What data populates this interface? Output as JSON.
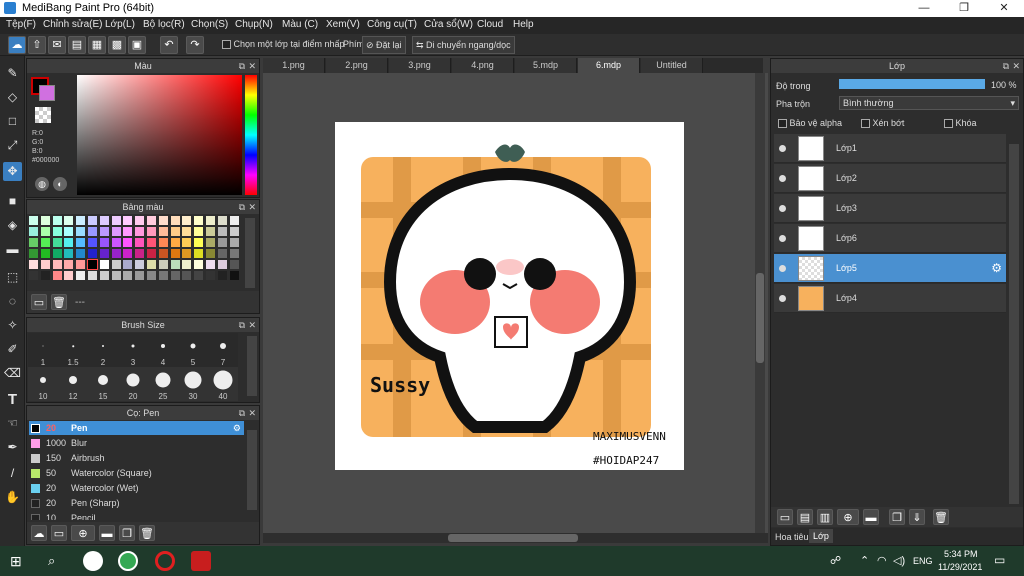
{
  "window": {
    "title": "MediBang Paint Pro (64bit)",
    "min": "—",
    "max": "❐",
    "close": "✕"
  },
  "menu": [
    "Tệp(F)",
    "Chỉnh sửa(E)",
    "Lớp(L)",
    "Bộ lọc(R)",
    "Chọn(S)",
    "Chụp(N)",
    "Màu (C)",
    "Xem(V)",
    "Công cụ(T)",
    "Cửa sổ(W)",
    "Cloud",
    "Help"
  ],
  "toolbar": {
    "select_layer_label": "Chọn một lớp tại điểm nhấp",
    "key_label": "Phím",
    "reset_label": "Đặt lại",
    "move_label": "Di chuyển ngang/dọc"
  },
  "color_panel": {
    "title": "Màu",
    "r": "R:0",
    "g": "G:0",
    "b": "B:0",
    "hex": "#000000"
  },
  "palette_panel": {
    "title": "Bảng màu",
    "footer": "---"
  },
  "brush_size_panel": {
    "title": "Brush Size",
    "sizes": [
      "1",
      "1.5",
      "2",
      "3",
      "4",
      "5",
      "7",
      "10",
      "12",
      "15",
      "20",
      "25",
      "30",
      "40"
    ]
  },
  "brush_panel": {
    "title": "Cọ: Pen",
    "items": [
      {
        "size": "20",
        "name": "Pen",
        "color": "#000000"
      },
      {
        "size": "1000",
        "name": "Blur",
        "color": "#ff9de8"
      },
      {
        "size": "150",
        "name": "Airbrush",
        "color": "#cccccc"
      },
      {
        "size": "50",
        "name": "Watercolor (Square)",
        "color": "#b8e86a"
      },
      {
        "size": "20",
        "name": "Watercolor (Wet)",
        "color": "#6ad0f0"
      },
      {
        "size": "20",
        "name": "Pen (Sharp)",
        "color": "#222222"
      },
      {
        "size": "10",
        "name": "Pencil",
        "color": "#222222"
      }
    ]
  },
  "tabs": [
    "1.png",
    "2.png",
    "3.png",
    "4.png",
    "5.mdp",
    "6.mdp",
    "Untitled"
  ],
  "active_tab": "6.mdp",
  "artwork": {
    "caption": "Sussy",
    "signature": "MAXIMUSVENN",
    "hashtag": "#HOIDAP247"
  },
  "layer_panel": {
    "title": "Lớp",
    "opacity_label": "Độ trong",
    "opacity_value": "100 %",
    "opacity_fraction": 1.0,
    "blend_label": "Pha trộn",
    "blend_value": "Bình thường",
    "protect_alpha": "Bảo vệ alpha",
    "clip": "Xén bớt",
    "lock": "Khóa",
    "layers": [
      "Lớp1",
      "Lớp2",
      "Lớp3",
      "Lớp6",
      "Lớp5",
      "Lớp4"
    ],
    "selected": "Lớp5",
    "bottom_tabs": [
      "Hoa tiêu",
      "Lớp"
    ]
  },
  "taskbar": {
    "time": "5:34 PM",
    "date": "11/29/2021",
    "lang": "ENG"
  }
}
